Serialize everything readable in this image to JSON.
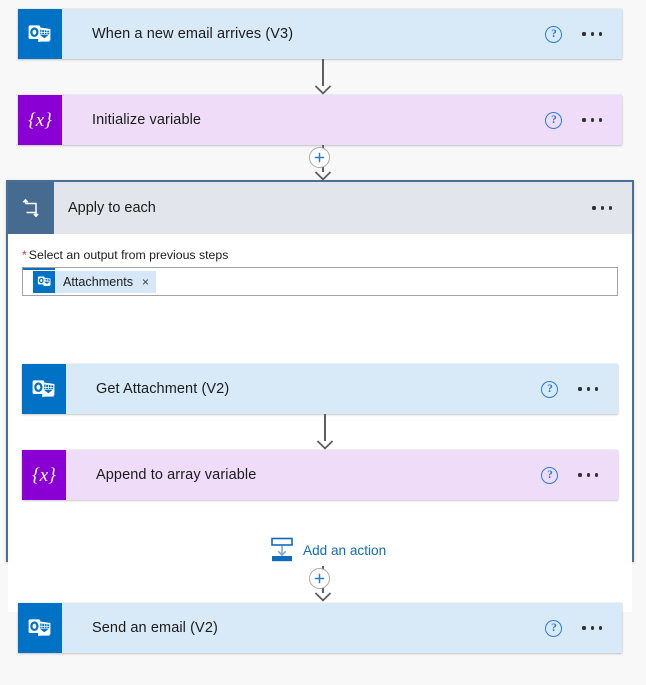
{
  "flow": {
    "steps": [
      {
        "id": "trigger-when-new-email",
        "title": "When a new email arrives (V3)",
        "icon": "outlook-icon",
        "theme": "blue",
        "help_label": "?",
        "menu_label": "More commands"
      },
      {
        "id": "initialize-variable",
        "title": "Initialize variable",
        "icon": "variable-icon",
        "theme": "lilac",
        "help_label": "?",
        "menu_label": "More commands"
      }
    ],
    "scope": {
      "id": "apply-to-each",
      "title": "Apply to each",
      "icon": "loop-icon",
      "menu_label": "More commands",
      "field": {
        "label": "Select an output from previous steps",
        "required_marker": "*",
        "token": {
          "text": "Attachments",
          "icon": "outlook-icon",
          "remove_label": "×"
        }
      },
      "inner_steps": [
        {
          "id": "get-attachment",
          "title": "Get Attachment (V2)",
          "icon": "outlook-icon",
          "theme": "blue",
          "help_label": "?",
          "menu_label": "More commands"
        },
        {
          "id": "append-to-array-variable",
          "title": "Append to array variable",
          "icon": "variable-icon",
          "theme": "lilac",
          "help_label": "?",
          "menu_label": "More commands"
        }
      ],
      "add_action": {
        "label": "Add an action",
        "icon": "insert-step-icon"
      }
    },
    "final_step": {
      "id": "send-an-email",
      "title": "Send an email (V2)",
      "icon": "outlook-icon",
      "theme": "blue",
      "help_label": "?",
      "menu_label": "More commands"
    },
    "insert_nodes": [
      {
        "id": "insert-after-initialize-variable",
        "label": "+"
      },
      {
        "id": "insert-after-apply-to-each",
        "label": "+"
      }
    ]
  },
  "colors": {
    "outlook_blue": "#0072c6",
    "variable_purple": "#8a00d4",
    "card_blue": "#d8eaf8",
    "card_lilac": "#efdcf8",
    "scope_border": "#4a6f94",
    "scope_header": "#e2e6ec",
    "scope_icon": "#476a91",
    "link_blue": "#0f6cbd",
    "required_red": "#c8342f",
    "canvas_bg": "#f8f8f8"
  }
}
